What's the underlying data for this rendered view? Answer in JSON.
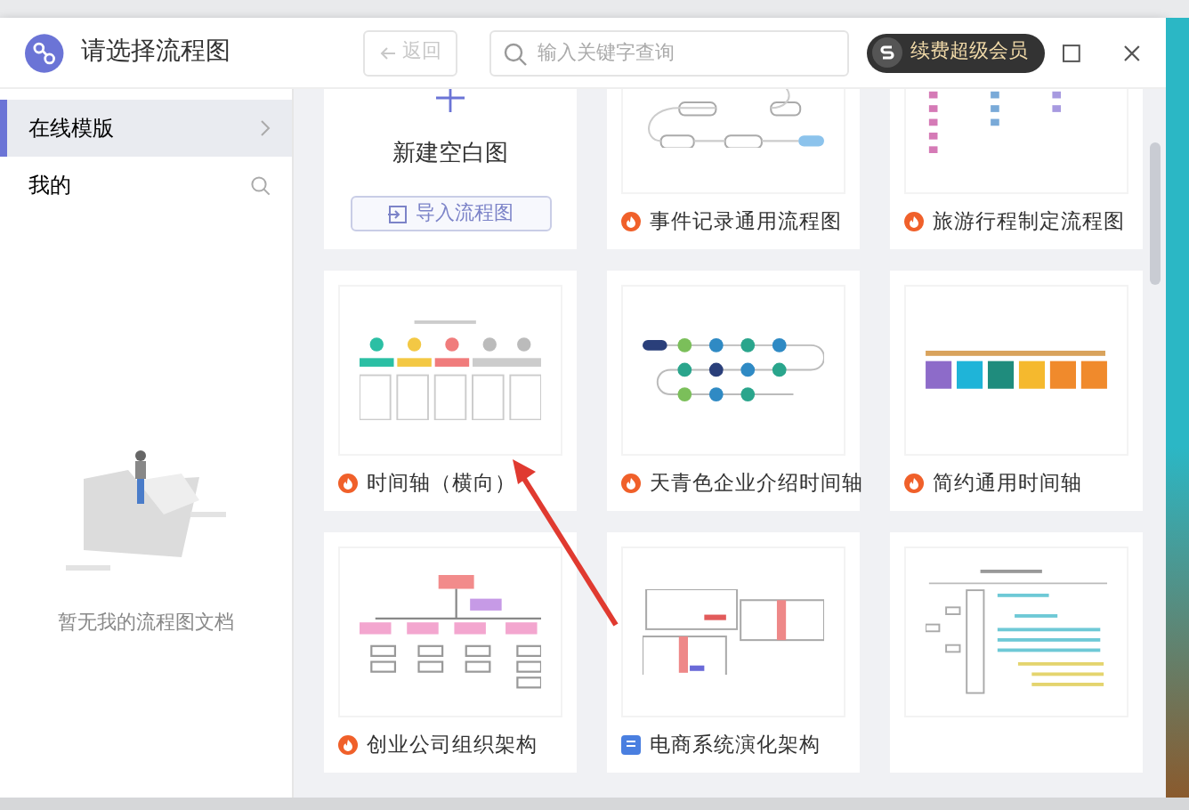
{
  "window": {
    "title": "请选择流程图"
  },
  "toolbar": {
    "back_button": "返回",
    "back_disabled": true,
    "search": {
      "placeholder": "输入关键字查询"
    },
    "vip_button": "续费超级会员"
  },
  "sidebar": {
    "items": [
      {
        "label": "在线模版",
        "selected": true,
        "kind": "nav"
      },
      {
        "label": "我的",
        "selected": false,
        "kind": "search"
      }
    ],
    "empty_text": "暂无我的流程图文档"
  },
  "blank": {
    "title": "新建空白图",
    "import_button": "导入流程图"
  },
  "templates": [
    {
      "name": "事件记录通用流程图",
      "kind": "process"
    },
    {
      "name": "旅游行程制定流程图",
      "kind": "itinerary"
    },
    {
      "name": "时间轴（横向）",
      "kind": "timeline"
    },
    {
      "name": "天青色企业介绍时间轴",
      "kind": "network"
    },
    {
      "name": "简约通用时间轴",
      "kind": "bars"
    },
    {
      "name": "创业公司组织架构",
      "kind": "org"
    },
    {
      "name": "电商系统演化架构",
      "kind": "architecture"
    },
    {
      "kind": "gantt"
    }
  ]
}
